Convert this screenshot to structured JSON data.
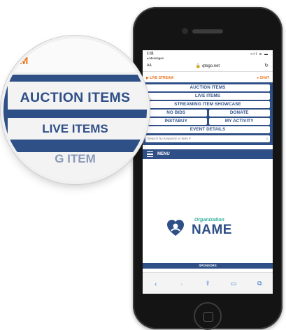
{
  "status": {
    "time": "1:11",
    "back": "◂ Messages",
    "signal": "••ll ≋ ▬"
  },
  "browser": {
    "aa": "AA",
    "url": "qtego.net",
    "reload": "↻"
  },
  "topbar": {
    "live": "LIVE STREAM",
    "chat": "CHAT"
  },
  "menu": {
    "auction": "AUCTION ITEMS",
    "live": "LIVE ITEMS",
    "streaming": "STREAMING ITEM SHOWCASE",
    "nobids": "NO BIDS",
    "donate": "DONATE",
    "instabuy": "INSTABUY",
    "activity": "MY ACTIVITY",
    "event": "EVENT DETAILS"
  },
  "search": {
    "placeholder": "Search by Keyword or Item #"
  },
  "menubar": {
    "label": "MENU"
  },
  "logo": {
    "org": "Organization",
    "name": "NAME"
  },
  "sponsors": "SPONSORS",
  "toolbar": {
    "back": "‹",
    "forward": "›",
    "share": "⇪",
    "bookmarks": "▭",
    "tabs": "⧉"
  },
  "magnifier": {
    "partial_top": "RM",
    "auction": "AUCTION ITEMS",
    "live": "LIVE ITEMS",
    "partial_bottom": "G ITEM"
  },
  "colors": {
    "brand_blue": "#2f4f87",
    "accent_orange": "#e8731c",
    "teal": "#2fae9a"
  }
}
